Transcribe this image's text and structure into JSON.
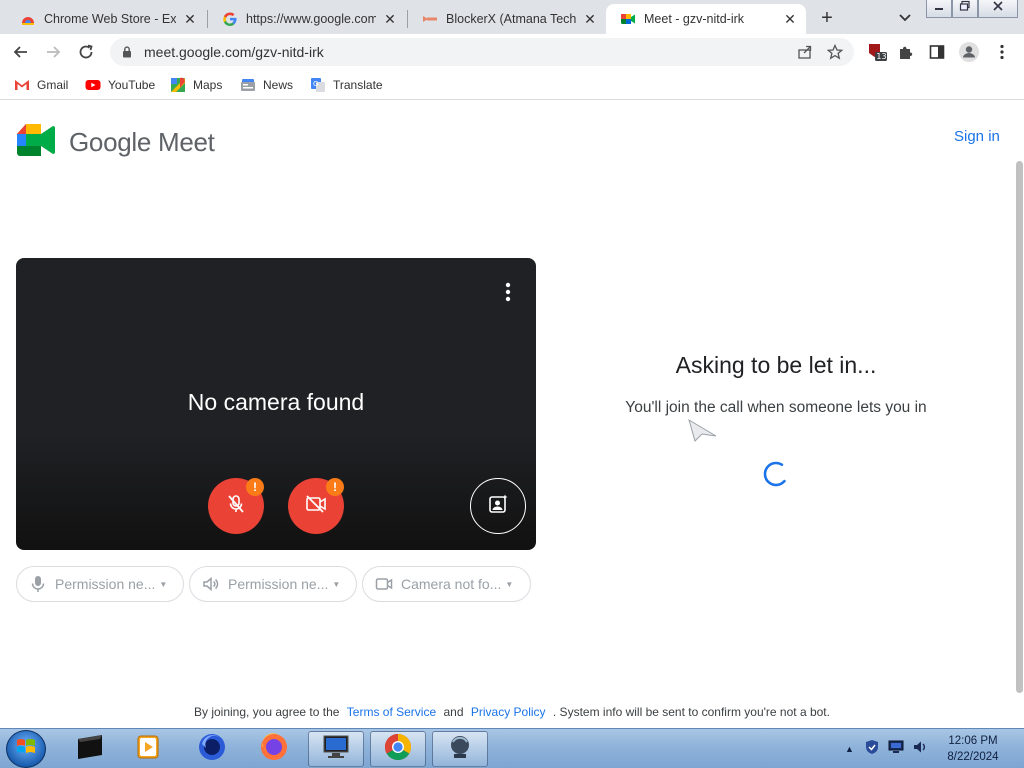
{
  "browser": {
    "tabs": [
      {
        "title": "Chrome Web Store - Exte",
        "active": false
      },
      {
        "title": "https://www.google.com",
        "active": false
      },
      {
        "title": "BlockerX (Atmana Tech)",
        "active": false
      },
      {
        "title": "Meet - gzv-nitd-irk",
        "active": true
      }
    ],
    "new_tab_label": "+",
    "url": "meet.google.com/gzv-nitd-irk",
    "extension_badge": "13",
    "bookmarks": [
      {
        "label": "Gmail",
        "icon": "gmail-icon"
      },
      {
        "label": "YouTube",
        "icon": "youtube-icon"
      },
      {
        "label": "Maps",
        "icon": "maps-icon"
      },
      {
        "label": "News",
        "icon": "news-icon"
      },
      {
        "label": "Translate",
        "icon": "translate-icon"
      }
    ]
  },
  "meet": {
    "brand": "Google Meet",
    "sign_in": "Sign in",
    "preview": {
      "no_camera": "No camera found",
      "warning_mark": "!"
    },
    "permissions": [
      {
        "label": "Permission ne...",
        "icon": "microphone-icon"
      },
      {
        "label": "Permission ne...",
        "icon": "speaker-icon"
      },
      {
        "label": "Camera not fo...",
        "icon": "camera-icon"
      }
    ],
    "asking_title": "Asking to be let in...",
    "asking_message": "You'll join the call when someone lets you in",
    "footer": {
      "prefix": "By joining, you agree to the",
      "terms": "Terms of Service",
      "and": "and",
      "privacy": "Privacy Policy",
      "suffix": ". System info will be sent to confirm you're not a bot."
    }
  },
  "taskbar": {
    "time": "12:06 PM",
    "date": "8/22/2024"
  },
  "colors": {
    "accent_blue": "#1a73e8",
    "mute_red": "#ea4335",
    "warning_orange": "#fa7b17",
    "preview_bg": "#202124"
  }
}
